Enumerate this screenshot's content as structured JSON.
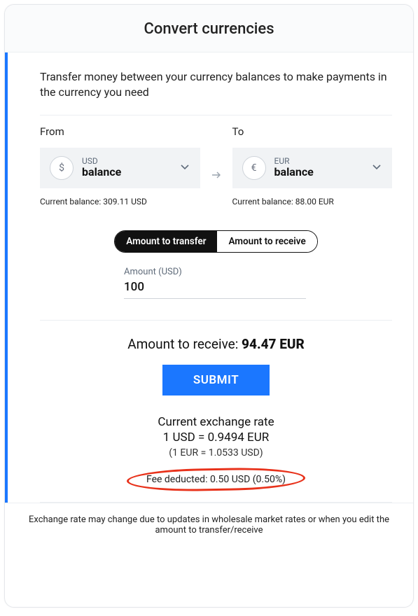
{
  "header": {
    "title": "Convert currencies"
  },
  "intro": "Transfer money between your currency balances to make payments in the currency you need",
  "from": {
    "label": "From",
    "currency": "USD",
    "balance_word": "balance",
    "symbol": "$",
    "current_balance": "Current balance: 309.11 USD"
  },
  "to": {
    "label": "To",
    "currency": "EUR",
    "balance_word": "balance",
    "symbol": "€",
    "current_balance": "Current balance: 88.00 EUR"
  },
  "segmented": {
    "transfer": "Amount to transfer",
    "receive": "Amount to receive",
    "active": "transfer"
  },
  "amount": {
    "label": "Amount (USD)",
    "value": "100"
  },
  "receive_line": {
    "prefix": "Amount to receive: ",
    "value": "94.47 EUR"
  },
  "submit_label": "SUBMIT",
  "rate": {
    "title": "Current exchange rate",
    "main": "1 USD = 0.9494 EUR",
    "sub": "(1 EUR = 1.0533 USD)"
  },
  "fee": "Fee deducted: 0.50 USD (0.50%)",
  "footer": "Exchange rate may change due to updates in wholesale market rates or when you edit the amount to transfer/receive"
}
